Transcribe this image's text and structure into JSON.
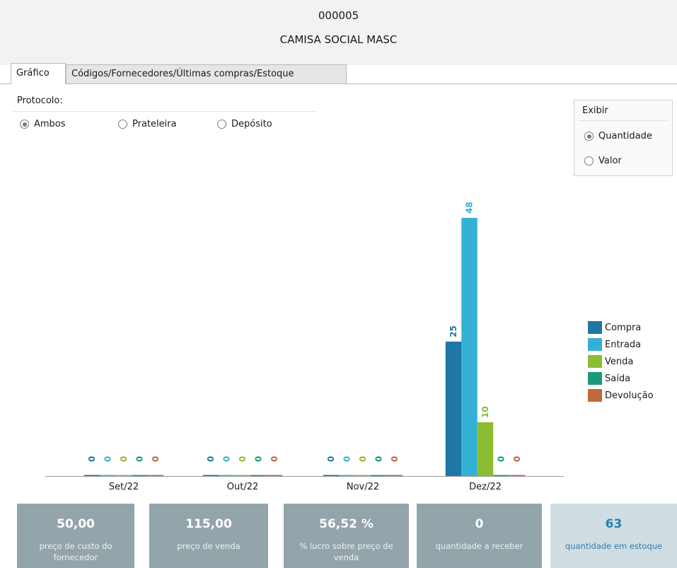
{
  "header": {
    "code": "000005",
    "product_name": "CAMISA SOCIAL MASC"
  },
  "tabs": [
    {
      "label": "Gráfico",
      "active": true
    },
    {
      "label": "Códigos/Fornecedores/Últimas compras/Estoque",
      "active": false
    }
  ],
  "protocol": {
    "label": "Protocolo:",
    "options": [
      {
        "label": "Ambos",
        "checked": true
      },
      {
        "label": "Prateleira",
        "checked": false
      },
      {
        "label": "Depósito",
        "checked": false
      }
    ]
  },
  "exibir": {
    "title": "Exibir",
    "options": [
      {
        "label": "Quantidade",
        "checked": true
      },
      {
        "label": "Valor",
        "checked": false
      }
    ]
  },
  "chart_data": {
    "type": "bar",
    "categories": [
      "Set/22",
      "Out/22",
      "Nov/22",
      "Dez/22"
    ],
    "series": [
      {
        "name": "Compra",
        "color": "#1f77a6",
        "values": [
          0,
          0,
          0,
          25
        ]
      },
      {
        "name": "Entrada",
        "color": "#35b0d5",
        "values": [
          0,
          0,
          0,
          48
        ]
      },
      {
        "name": "Venda",
        "color": "#8cbd30",
        "values": [
          0,
          0,
          0,
          10
        ]
      },
      {
        "name": "Saída",
        "color": "#1a9a7a",
        "values": [
          0,
          0,
          0,
          0
        ]
      },
      {
        "name": "Devolução",
        "color": "#c0693a",
        "values": [
          0,
          0,
          0,
          0
        ]
      }
    ],
    "ylim": [
      0,
      48
    ],
    "grid": false,
    "legend_position": "right"
  },
  "stats": [
    {
      "value": "50,00",
      "label": "preço de custo do fornecedor",
      "highlight": false
    },
    {
      "value": "115,00",
      "label": "preço de venda",
      "highlight": false
    },
    {
      "value": "56,52 %",
      "label": "% lucro sobre preço de venda",
      "highlight": false
    },
    {
      "value": "0",
      "label": "quantidade a receber",
      "highlight": false
    },
    {
      "value": "63",
      "label": "quantidade em estoque",
      "highlight": true
    }
  ]
}
